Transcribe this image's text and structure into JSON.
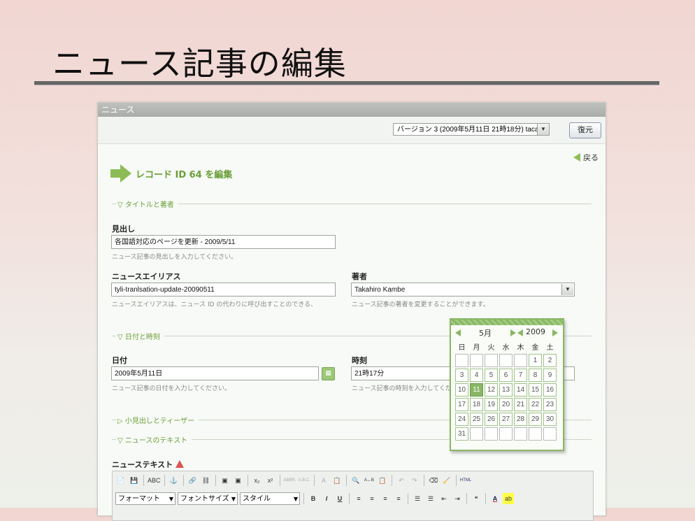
{
  "slide": {
    "title": "ニュース記事の編集"
  },
  "window": {
    "header": "ニュース",
    "version_select": "バージョン 3 (2009年5月11日 21時18分) taca",
    "restore_button": "復元",
    "back_link": "戻る",
    "page_heading": "レコード ID 64 を編集"
  },
  "sections": {
    "title_author": "▽ タイトルと著者",
    "datetime": "▽ 日付と時刻",
    "subheading_teaser": "▷ 小見出しとティーザー",
    "news_text": "▽ ニュースのテキスト"
  },
  "fields": {
    "headline": {
      "label": "見出し",
      "value": "各国語対応のページを更新 - 2009/5/11",
      "hint": "ニュース記事の見出しを入力してください。"
    },
    "alias": {
      "label": "ニュースエイリアス",
      "value": "tyli-tranlsation-update-20090511",
      "hint": "ニュースエイリアスは、ニュース ID の代わりに呼び出すことのできる、"
    },
    "author": {
      "label": "著者",
      "value": "Takahiro Kambe",
      "hint": "ニュース記事の著者を変更することができます。"
    },
    "date": {
      "label": "日付",
      "value": "2009年5月11日",
      "hint": "ニュース記事の日付を入力してください。"
    },
    "time": {
      "label": "時刻",
      "value": "21時17分",
      "hint": "ニュース記事の時刻を入力してください。"
    },
    "news_text": {
      "label": "ニューステキスト"
    }
  },
  "editor": {
    "row1": [
      "📄",
      "💾",
      "ABC",
      "⚓",
      "🔗",
      "⛓",
      "▣",
      "▣",
      "x₂",
      "x²",
      "ABBR.",
      "A.B.C.",
      "A",
      "📋",
      "🔍",
      "A↔B",
      "📋",
      "↶",
      "↷",
      "⌫",
      "🧹",
      "HTML"
    ],
    "dropdowns": [
      "フォーマット",
      "フォントサイズ",
      "スタイル"
    ],
    "row2": [
      "B",
      "I",
      "U",
      "≡",
      "≡",
      "≡",
      "≡",
      "☰",
      "☰",
      "⇤",
      "⇥",
      "❝",
      "A",
      "ab"
    ]
  },
  "calendar": {
    "month": "5月",
    "year": "2009",
    "weekdays": [
      "日",
      "月",
      "火",
      "水",
      "木",
      "金",
      "土"
    ],
    "days": [
      "",
      "",
      "",
      "",
      "",
      "1",
      "2",
      "3",
      "4",
      "5",
      "6",
      "7",
      "8",
      "9",
      "10",
      "11",
      "12",
      "13",
      "14",
      "15",
      "16",
      "17",
      "18",
      "19",
      "20",
      "21",
      "22",
      "23",
      "24",
      "25",
      "26",
      "27",
      "28",
      "29",
      "30",
      "31",
      "",
      "",
      "",
      "",
      "",
      ""
    ],
    "selected": "11"
  },
  "colors": {
    "accent": "#8ab766",
    "heading": "#6a9e37"
  }
}
